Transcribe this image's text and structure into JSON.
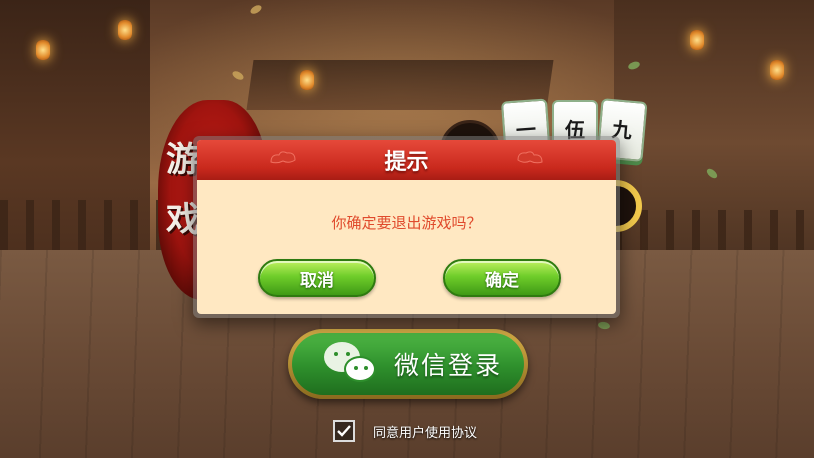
{
  "background": {
    "logo_text": "游戏",
    "mahjong_tiles": [
      "一",
      "伍",
      "九"
    ]
  },
  "dialog": {
    "title": "提示",
    "message": "你确定要退出游戏吗？",
    "cancel_label": "取消",
    "confirm_label": "确定"
  },
  "login": {
    "wechat_label": "微信登录",
    "agree_label": "同意用户使用协议",
    "agree_checked": true
  },
  "colors": {
    "dialog_header": "#c9291d",
    "dialog_body": "#ffe8c2",
    "message_text": "#e04a2c",
    "button_green": "#6fcd2a",
    "wechat_green": "#2e8f2c",
    "gold_border": "#d9b048"
  }
}
